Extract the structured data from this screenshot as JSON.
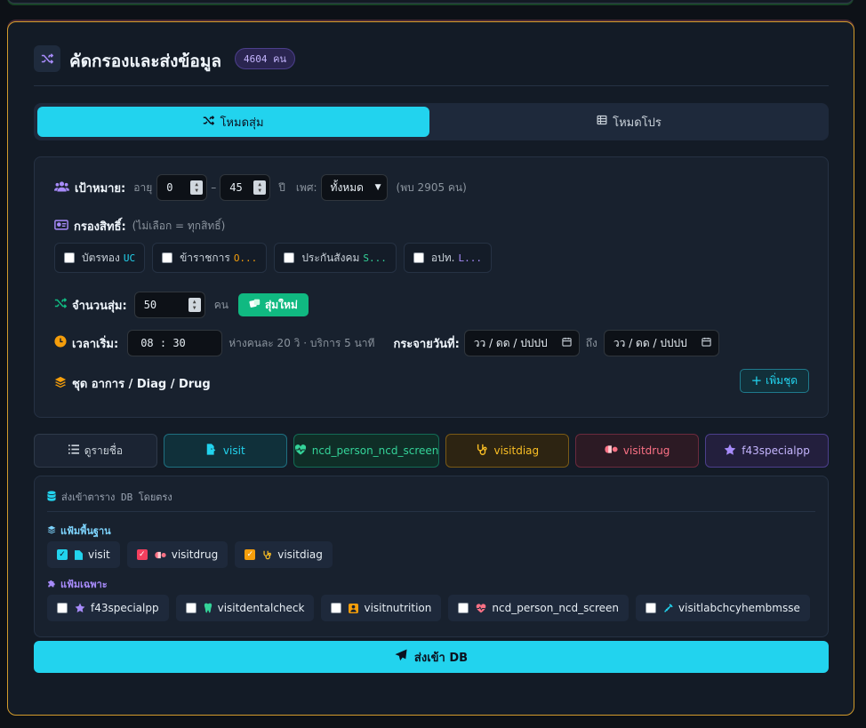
{
  "header": {
    "title": "คัดกรองและส่งข้อมูล",
    "badge": "4604 คน"
  },
  "modes": [
    {
      "label": "โหมดสุ่ม",
      "active": true
    },
    {
      "label": "โหมดโปร",
      "active": false
    }
  ],
  "target": {
    "label": "เป้าหมาย:",
    "age_label": "อายุ",
    "age_min": "0",
    "age_sep": "–",
    "age_max": "45",
    "unit": "ปี",
    "sex_label": "เพศ:",
    "sex_value": "ทั้งหมด",
    "found": "(พบ 2905 คน)"
  },
  "rights": {
    "label": "กรองสิทธิ์:",
    "hint": "(ไม่เลือก = ทุกสิทธิ์)",
    "items": [
      {
        "label": "บัตรทอง",
        "tag": "UC",
        "tag_color": "#22d3ee"
      },
      {
        "label": "ข้าราชการ",
        "tag": "O...",
        "tag_color": "#f59e0b"
      },
      {
        "label": "ประกันสังคม",
        "tag": "S...",
        "tag_color": "#34d399"
      },
      {
        "label": "อปท.",
        "tag": "L...",
        "tag_color": "#a78bfa"
      }
    ]
  },
  "random": {
    "label": "จำนวนสุ่ม:",
    "value": "50",
    "unit": "คน",
    "button": "สุ่มใหม่"
  },
  "time": {
    "label": "เวลาเริ่ม:",
    "value": "08 : 30",
    "note": "ห่างคนละ 20 วิ · บริการ 5 นาที",
    "dist_label": "กระจายวันที่:",
    "date_placeholder_1": "วว / ดด / ปปปป",
    "to_label": "ถึง",
    "date_placeholder_2": "วว / ดด / ปปปป"
  },
  "set": {
    "label": "ชุด อาการ / Diag / Drug",
    "add_button": "เพิ่มชุด"
  },
  "tabs": [
    {
      "label": "ดูรายชื่อ"
    },
    {
      "label": "visit"
    },
    {
      "label": "ncd_person_ncd_screen"
    },
    {
      "label": "visitdiag"
    },
    {
      "label": "visitdrug"
    },
    {
      "label": "f43specialpp"
    }
  ],
  "db": {
    "title": "ส่งเข้าตาราง DB โดยตรง",
    "base_label": "แฟ้มพื้นฐาน",
    "base_files": [
      {
        "label": "visit",
        "checked": true
      },
      {
        "label": "visitdrug",
        "checked": true
      },
      {
        "label": "visitdiag",
        "checked": true
      }
    ],
    "special_label": "แฟ้มเฉพาะ",
    "special_files": [
      {
        "label": "f43specialpp",
        "checked": false
      },
      {
        "label": "visitdentalcheck",
        "checked": false
      },
      {
        "label": "visitnutrition",
        "checked": false
      },
      {
        "label": "ncd_person_ncd_screen",
        "checked": false
      },
      {
        "label": "visitlabchcyhembmsse",
        "checked": false
      }
    ],
    "send_button": "ส่งเข้า DB"
  }
}
